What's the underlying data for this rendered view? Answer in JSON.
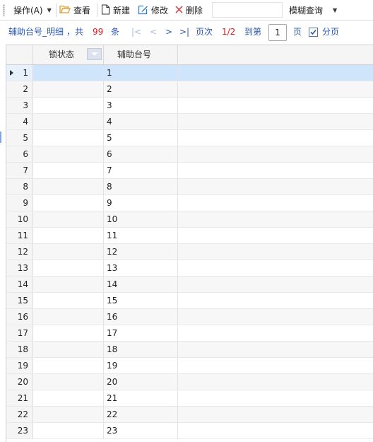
{
  "toolbar": {
    "operate_label": "操作(A)",
    "view_label": "查看",
    "new_label": "新建",
    "edit_label": "修改",
    "delete_label": "删除",
    "fuzzy_query_label": "模糊查询",
    "search_value": ""
  },
  "pager": {
    "title": "辅助台号_明细",
    "total_prefix": "，共",
    "total_count": "99",
    "total_suffix": "条",
    "first": "|<",
    "prev": "<",
    "next": ">",
    "last": ">|",
    "page_label": "页次",
    "page_info": "1/2",
    "goto_label": "到第",
    "goto_value": "1",
    "page_unit": "页",
    "paging_label": "分页",
    "paging_checked": true
  },
  "grid": {
    "columns": [
      "锁状态",
      "辅助台号"
    ],
    "rows": [
      {
        "index": "1",
        "lock": "",
        "code": "1"
      },
      {
        "index": "2",
        "lock": "",
        "code": "2"
      },
      {
        "index": "3",
        "lock": "",
        "code": "3"
      },
      {
        "index": "4",
        "lock": "",
        "code": "4"
      },
      {
        "index": "5",
        "lock": "",
        "code": "5"
      },
      {
        "index": "6",
        "lock": "",
        "code": "6"
      },
      {
        "index": "7",
        "lock": "",
        "code": "7"
      },
      {
        "index": "8",
        "lock": "",
        "code": "8"
      },
      {
        "index": "9",
        "lock": "",
        "code": "9"
      },
      {
        "index": "10",
        "lock": "",
        "code": "10"
      },
      {
        "index": "11",
        "lock": "",
        "code": "11"
      },
      {
        "index": "12",
        "lock": "",
        "code": "12"
      },
      {
        "index": "13",
        "lock": "",
        "code": "13"
      },
      {
        "index": "14",
        "lock": "",
        "code": "14"
      },
      {
        "index": "15",
        "lock": "",
        "code": "15"
      },
      {
        "index": "16",
        "lock": "",
        "code": "16"
      },
      {
        "index": "17",
        "lock": "",
        "code": "17"
      },
      {
        "index": "18",
        "lock": "",
        "code": "18"
      },
      {
        "index": "19",
        "lock": "",
        "code": "19"
      },
      {
        "index": "20",
        "lock": "",
        "code": "20"
      },
      {
        "index": "21",
        "lock": "",
        "code": "21"
      },
      {
        "index": "22",
        "lock": "",
        "code": "22"
      },
      {
        "index": "23",
        "lock": "",
        "code": "23"
      }
    ]
  },
  "colors": {
    "pager_text": "#2a56b4",
    "count_text": "#e0181a",
    "selected_row": "#cfe5fb",
    "view_icon": "#d99a2b",
    "edit_icon": "#2f7bd6",
    "delete_icon": "#d33"
  },
  "icons": {
    "view": "folder-open-icon",
    "new": "new-document-icon",
    "edit": "edit-icon",
    "delete": "delete-x-icon",
    "row_indicator": "current-row-arrow-icon",
    "paging": "checkbox-checked-icon"
  }
}
